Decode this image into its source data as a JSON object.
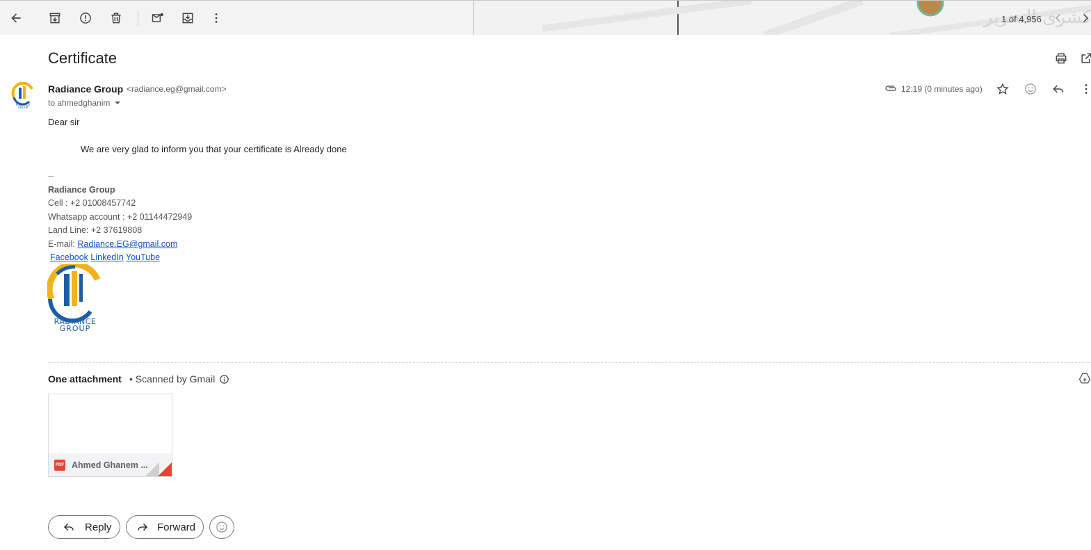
{
  "toolbar": {
    "counter": "1 of 4,956",
    "map_text": "كشرى التحرير"
  },
  "email": {
    "subject": "Certificate",
    "sender_name": "Radiance Group",
    "sender_email": "<radiance.eg@gmail.com>",
    "to_line": "to ahmedghanim",
    "timestamp": "12:19 (0 minutes ago)",
    "greeting": "Dear sir",
    "body": "We are very glad to inform you that your certificate is Already done"
  },
  "signature": {
    "dashes": "--",
    "company": "Radiance Group",
    "cell": "Cell : +2 01008457742",
    "whatsapp": "Whatsapp account : +2 01144472949",
    "landline": "Land Line: +2 37619808",
    "email_label": "E-mail: ",
    "email_link": "Radiance.EG@gmail.com",
    "links": [
      "Facebook",
      "LinkedIn",
      "YouTube"
    ],
    "logo_text_1": "RADIANCE",
    "logo_text_2": "GROUP",
    "avatar_text_1": "RADIANCE",
    "avatar_text_2": "GROUP"
  },
  "attachments": {
    "title": "One attachment",
    "scanned": "• Scanned by Gmail",
    "file_name": "Ahmed Ghanem ...",
    "file_type": "PDF"
  },
  "actions": {
    "reply": "Reply",
    "forward": "Forward"
  },
  "colors": {
    "brand_blue": "#1b5ea8",
    "brand_yellow": "#f2b21b",
    "link": "#1155cc",
    "pdf_red": "#ea4335"
  }
}
